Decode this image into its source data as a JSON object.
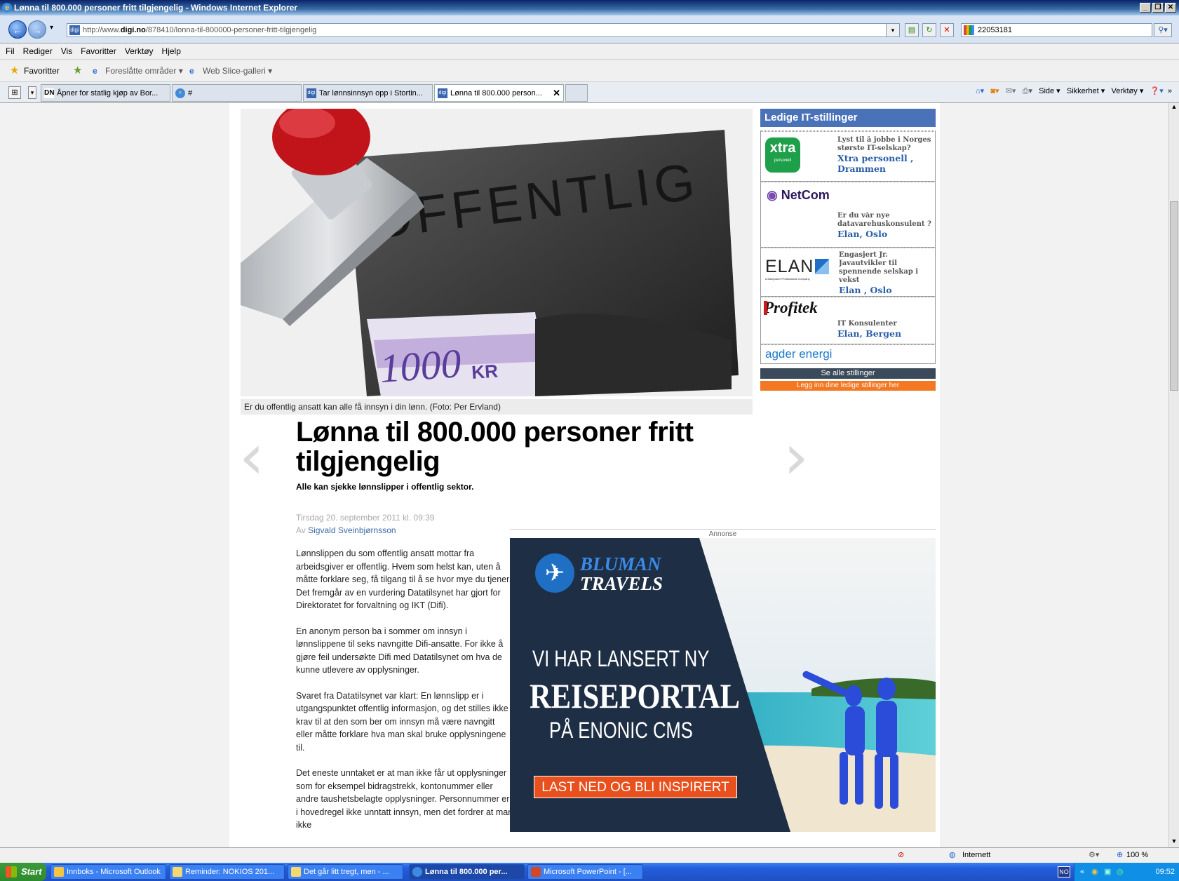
{
  "window": {
    "title": "Lønna til 800.000 personer fritt tilgjengelig - Windows Internet Explorer"
  },
  "address": {
    "url_prefix": "http://www.",
    "url_domain": "digi.no",
    "url_path": "/878410/lonna-til-800000-personer-fritt-tilgjengelig",
    "search_value": "22053181"
  },
  "menu": [
    "Fil",
    "Rediger",
    "Vis",
    "Favoritter",
    "Verktøy",
    "Hjelp"
  ],
  "favbar": {
    "favorites": "Favoritter",
    "suggested": "Foreslåtte områder ▾",
    "webslice": "Web Slice-galleri ▾"
  },
  "tabs": [
    {
      "label": "Åpner for statlig kjøp av Bor..."
    },
    {
      "label": "#"
    },
    {
      "label": "Tar lønnsinnsyn opp i Stortin..."
    },
    {
      "label": "Lønna til 800.000 person..."
    }
  ],
  "cmdbar": {
    "side": "Side ▾",
    "sikkerhet": "Sikkerhet ▾",
    "verktoy": "Verktøy ▾"
  },
  "article": {
    "image_text": "OFFENTLIG",
    "note_text": "1000",
    "note_kr": "KR",
    "caption": "Er du offentlig ansatt kan alle få innsyn i din lønn. (Foto: Per Ervland)",
    "headline": "Lønna til 800.000 personer fritt tilgjengelig",
    "ingress": "Alle kan sjekke lønnslipper i offentlig sektor.",
    "date": "Tirsdag 20. september 2011 kl. 09:39",
    "by_prefix": "Av",
    "author": "Sigvald Sveinbjørnsson",
    "paragraphs": [
      "Lønnslippen du som offentlig ansatt mottar fra arbeidsgiver er offentlig. Hvem som helst kan, uten å måtte forklare seg, få tilgang til å se hvor mye du tjener. Det fremgår av en vurdering Datatilsynet har gjort for Direktoratet for forvaltning og IKT (Difi).",
      "En anonym person ba i sommer om innsyn i lønnslippene til seks navngitte Difi-ansatte. For ikke å gjøre feil undersøkte Difi med Datatilsynet om hva de kunne utlevere av opplysninger.",
      "Svaret fra Datatilsynet var klart: En lønnslipp er i utgangspunktet offentlig informasjon, og det stilles ikke krav til at den som ber om innsyn må være navngitt eller måtte forklare hva man skal bruke opplysningene til.",
      "Det eneste unntaket er at man ikke får ut opplysninger som for eksempel bidragstrekk, kontonummer eller andre taushetsbelagte opplysninger. Personnummer er i hovedregel ikke unntatt innsyn, men det fordrer at man ikke"
    ]
  },
  "jobs": {
    "header": "Ledige IT-stillinger",
    "items": [
      {
        "logo": "xtra",
        "logo_sub": "personell",
        "lines": [
          "Lyst til å jobbe i Norges",
          "største IT-selskap?"
        ],
        "company": "Xtra personell ,",
        "location": "Drammen"
      },
      {
        "logo": "NetCom",
        "lines": [
          "Er du vår nye",
          "datavarehuskonsulent ?"
        ],
        "company": "Elan, Oslo"
      },
      {
        "logo": "ELAN",
        "logo_sub": "A Manpower Professional Company",
        "lines": [
          "Engasjert Jr.",
          "Javautvikler til",
          "spennende selskap i",
          "vekst"
        ],
        "company": "Elan , Oslo"
      },
      {
        "logo": "Profitek",
        "lines": [
          "IT Konsulenter"
        ],
        "company": "Elan, Bergen"
      },
      {
        "logo": "agder energi"
      }
    ],
    "see_all": "Se alle stillinger",
    "post": "Legg inn dine ledige stillinger her"
  },
  "ad": {
    "label": "Annonse",
    "brand1": "BLUMAN",
    "brand2": "TRAVELS",
    "line1": "VI HAR LANSERT NY",
    "line2": "REISEPORTAL",
    "line3": "PÅ ENONIC CMS",
    "cta": "LAST NED OG BLI INSPIRERT"
  },
  "status": {
    "zone": "Internett",
    "zoom": "100 %"
  },
  "taskbar": {
    "start": "Start",
    "items": [
      {
        "label": "Innboks - Microsoft Outlook"
      },
      {
        "label": "Reminder: NOKIOS 201..."
      },
      {
        "label": "Det går litt tregt, men - ..."
      },
      {
        "label": "Lønna til 800.000 per..."
      },
      {
        "label": "Microsoft PowerPoint - [..."
      }
    ],
    "lang": "NO",
    "clock": "09:52"
  },
  "colors": {
    "jobs_header": "#4a72b8",
    "see_all_bg": "#3a4a5a",
    "post_bg": "#f47721",
    "link": "#3a6aa8",
    "cta": "#e8501e"
  }
}
